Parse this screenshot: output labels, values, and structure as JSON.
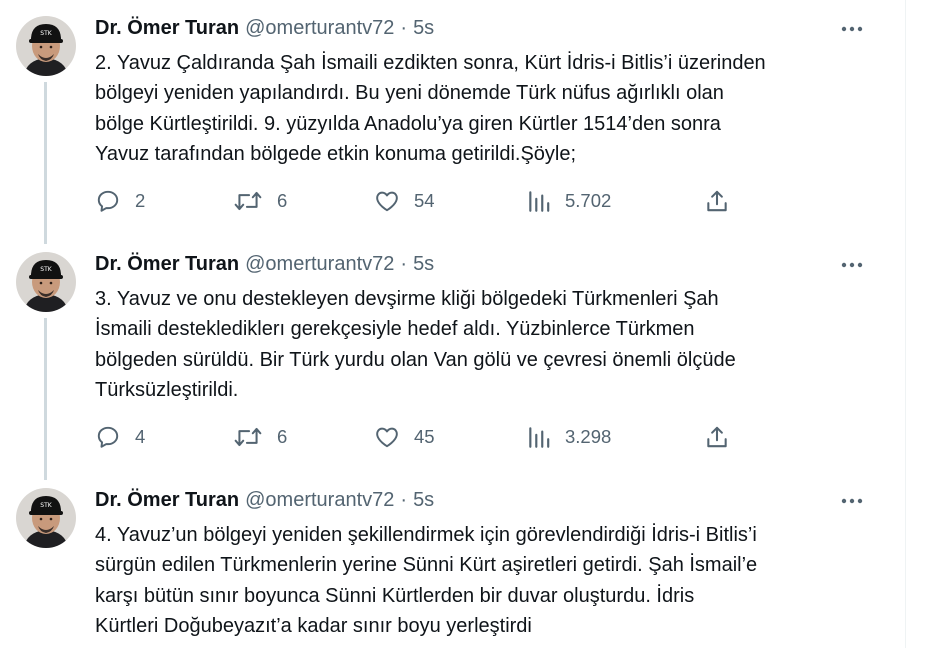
{
  "tweets": [
    {
      "author": "Dr. Ömer Turan",
      "handle": "@omerturantv72",
      "separator": "·",
      "time": "5s",
      "lines": [
        "2. Yavuz Çaldıranda Şah İsmaili ezdikten sonra, Kürt İdris-i Bitlis’i üzerinden",
        "bölgeyi yeniden yapılandırdı. Bu yeni dönemde Türk nüfus ağırlıklı olan",
        "bölge Kürtleştirildi. 9. yüzyılda Anadolu’ya giren Kürtler 1514’den sonra",
        "Yavuz tarafından bölgede etkin konuma getirildi.Şöyle;"
      ],
      "replies": "2",
      "retweets": "6",
      "likes": "54",
      "views": "5.702"
    },
    {
      "author": "Dr. Ömer Turan",
      "handle": "@omerturantv72",
      "separator": "·",
      "time": "5s",
      "lines": [
        "3. Yavuz ve onu destekleyen devşirme kliği bölgedeki Türkmenleri Şah",
        "İsmaili desteklediklerı gerekçesiyle hedef aldı. Yüzbinlerce Türkmen",
        "bölgeden sürüldü. Bir Türk yurdu olan Van gölü ve çevresi önemli ölçüde",
        "Türksüzleştirildi."
      ],
      "replies": "4",
      "retweets": "6",
      "likes": "45",
      "views": "3.298"
    },
    {
      "author": "Dr. Ömer Turan",
      "handle": "@omerturantv72",
      "separator": "·",
      "time": "5s",
      "lines": [
        "4. Yavuz’un bölgeyi yeniden şekillendirmek için görevlendirdiği İdris-i Bitlis’i",
        "sürgün edilen Türkmenlerin yerine Sünni Kürt aşiretleri getirdi. Şah İsmail’e",
        "karşı bütün sınır boyunca Sünni Kürtlerden bir duvar oluşturdu. İdris",
        "Kürtleri Doğubeyazıt’a kadar sınır boyu yerleştirdi"
      ]
    }
  ],
  "icons": {
    "more": "more-horizontal-icon",
    "reply": "reply-bubble-icon",
    "retweet": "retweet-arrows-icon",
    "like": "heart-outline-icon",
    "views": "analytics-bars-icon",
    "share": "share-upload-icon"
  },
  "colors": {
    "text": "#0f1419",
    "secondary": "#536471",
    "thread_line": "#cfd9de",
    "background": "#ffffff"
  }
}
